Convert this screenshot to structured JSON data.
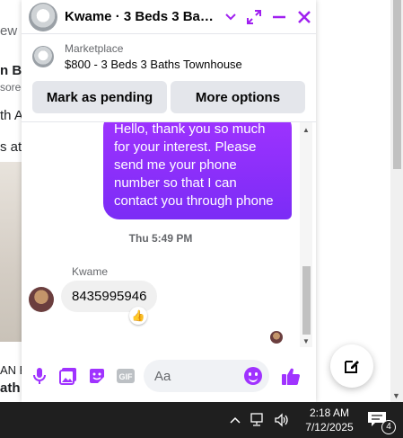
{
  "background_page": {
    "fragments": [
      "ew c",
      "n Bro",
      "sored",
      "th Ap",
      "s at",
      "AN Br",
      "ath"
    ]
  },
  "chat": {
    "title": "Kwame · 3 Beds 3 Bath...",
    "listing": {
      "source": "Marketplace",
      "title": "$800 - 3 Beds 3 Baths Townhouse",
      "buttons": [
        "Mark as pending",
        "More options"
      ]
    },
    "messages": {
      "outgoing_text": "Hello, thank you so much for your interest. Please send me your phone number so that I can contact you through phone",
      "timestamp": "Thu 5:49 PM",
      "sender_name": "Kwame",
      "incoming_text": "8435995946",
      "reaction": "👍"
    },
    "composer": {
      "placeholder": "Aa",
      "icons": [
        "microphone-icon",
        "photo-icon",
        "sticker-icon",
        "gif-icon",
        "emoji-icon",
        "like-icon"
      ]
    },
    "accent_color": "#a033ff"
  },
  "taskbar": {
    "time": "2:18 AM",
    "date": "7/12/2025",
    "notification_count": "4"
  }
}
